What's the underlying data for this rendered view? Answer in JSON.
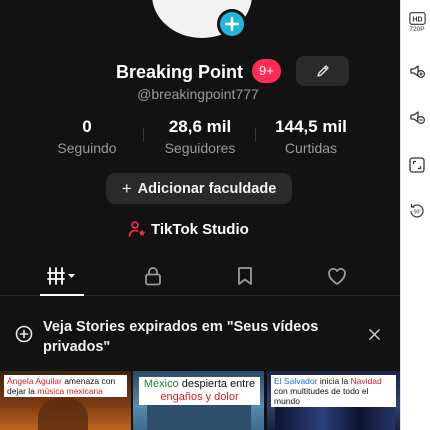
{
  "profile": {
    "display_name": "Breaking Point",
    "notification_badge": "9+",
    "username": "@breakingpoint777"
  },
  "stats": [
    {
      "value": "0",
      "label": "Seguindo"
    },
    {
      "value": "28,6 mil",
      "label": "Seguidores"
    },
    {
      "value": "144,5 mil",
      "label": "Curtidas"
    }
  ],
  "actions": {
    "add_bio_plus": "+",
    "add_bio_label": "Adicionar faculdade",
    "studio_label": "TikTok Studio"
  },
  "tabs": [
    {
      "icon": "videos-grid-icon",
      "selected": true
    },
    {
      "icon": "lock-icon",
      "selected": false
    },
    {
      "icon": "bookmark-icon",
      "selected": false
    },
    {
      "icon": "heart-icon",
      "selected": false
    }
  ],
  "stories_banner": {
    "text": "Veja Stories expirados em \"Seus vídeos privados\"",
    "close_glyph": "×"
  },
  "thumbnails": [
    {
      "caption_parts": [
        "Ángela Aguilar",
        " amenaza con dejar la ",
        "música mexicana"
      ]
    },
    {
      "caption_parts": [
        "México",
        " despierta entre ",
        "engaños y dolor"
      ]
    },
    {
      "caption_parts": [
        "El Salvador",
        " inicia la ",
        "Navidad",
        " con multitudes de todo el mundo"
      ]
    }
  ],
  "toolbar": {
    "hd_label": "720P",
    "hd_text": "HD"
  },
  "colors": {
    "background": "#121212",
    "accent_pink": "#fe2c55",
    "avatar_add": "#20b8d8"
  }
}
